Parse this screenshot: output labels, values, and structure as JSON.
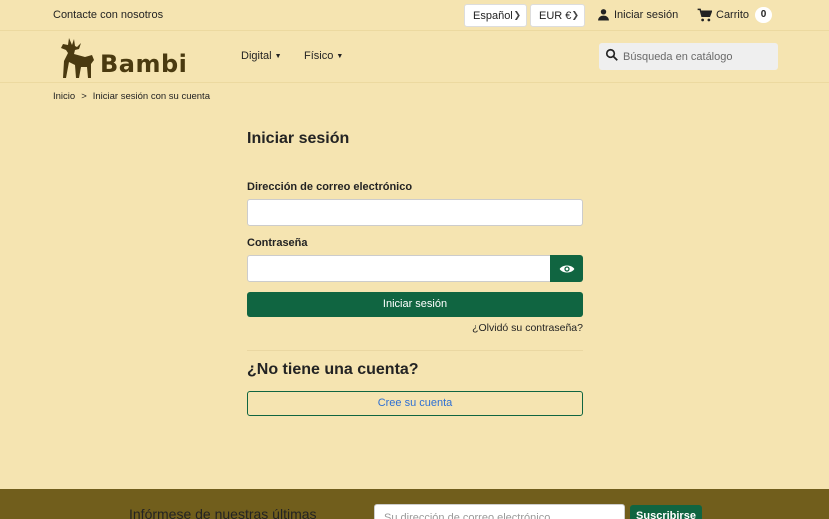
{
  "topbar": {
    "contact": "Contacte con nosotros",
    "language": "Español",
    "currency": "EUR €",
    "login": "Iniciar sesión",
    "cart_label": "Carrito",
    "cart_count": "0"
  },
  "header": {
    "logo_text": "Bambi",
    "nav": [
      {
        "label": "Digital"
      },
      {
        "label": "Físico"
      }
    ],
    "search_placeholder": "Búsqueda en catálogo"
  },
  "breadcrumb": {
    "home": "Inicio",
    "separator": ">",
    "current": "Iniciar sesión con su cuenta"
  },
  "login_form": {
    "title": "Iniciar sesión",
    "email_label": "Dirección de correo electrónico",
    "email_value": "",
    "password_label": "Contraseña",
    "password_value": "",
    "submit_label": "Iniciar sesión",
    "forgot_label": "¿Olvidó su contraseña?",
    "no_account_heading": "¿No tiene una cuenta?",
    "create_account_label": "Cree su cuenta"
  },
  "footer": {
    "newsletter_text": "Infórmese de nuestras últimas",
    "newsletter_placeholder": "Su dirección de correo electrónico",
    "subscribe_label": "Suscribirse"
  },
  "colors": {
    "background": "#f5e4b1",
    "primary": "#106541",
    "footer": "#715e1c",
    "link": "#2e6fd3"
  }
}
